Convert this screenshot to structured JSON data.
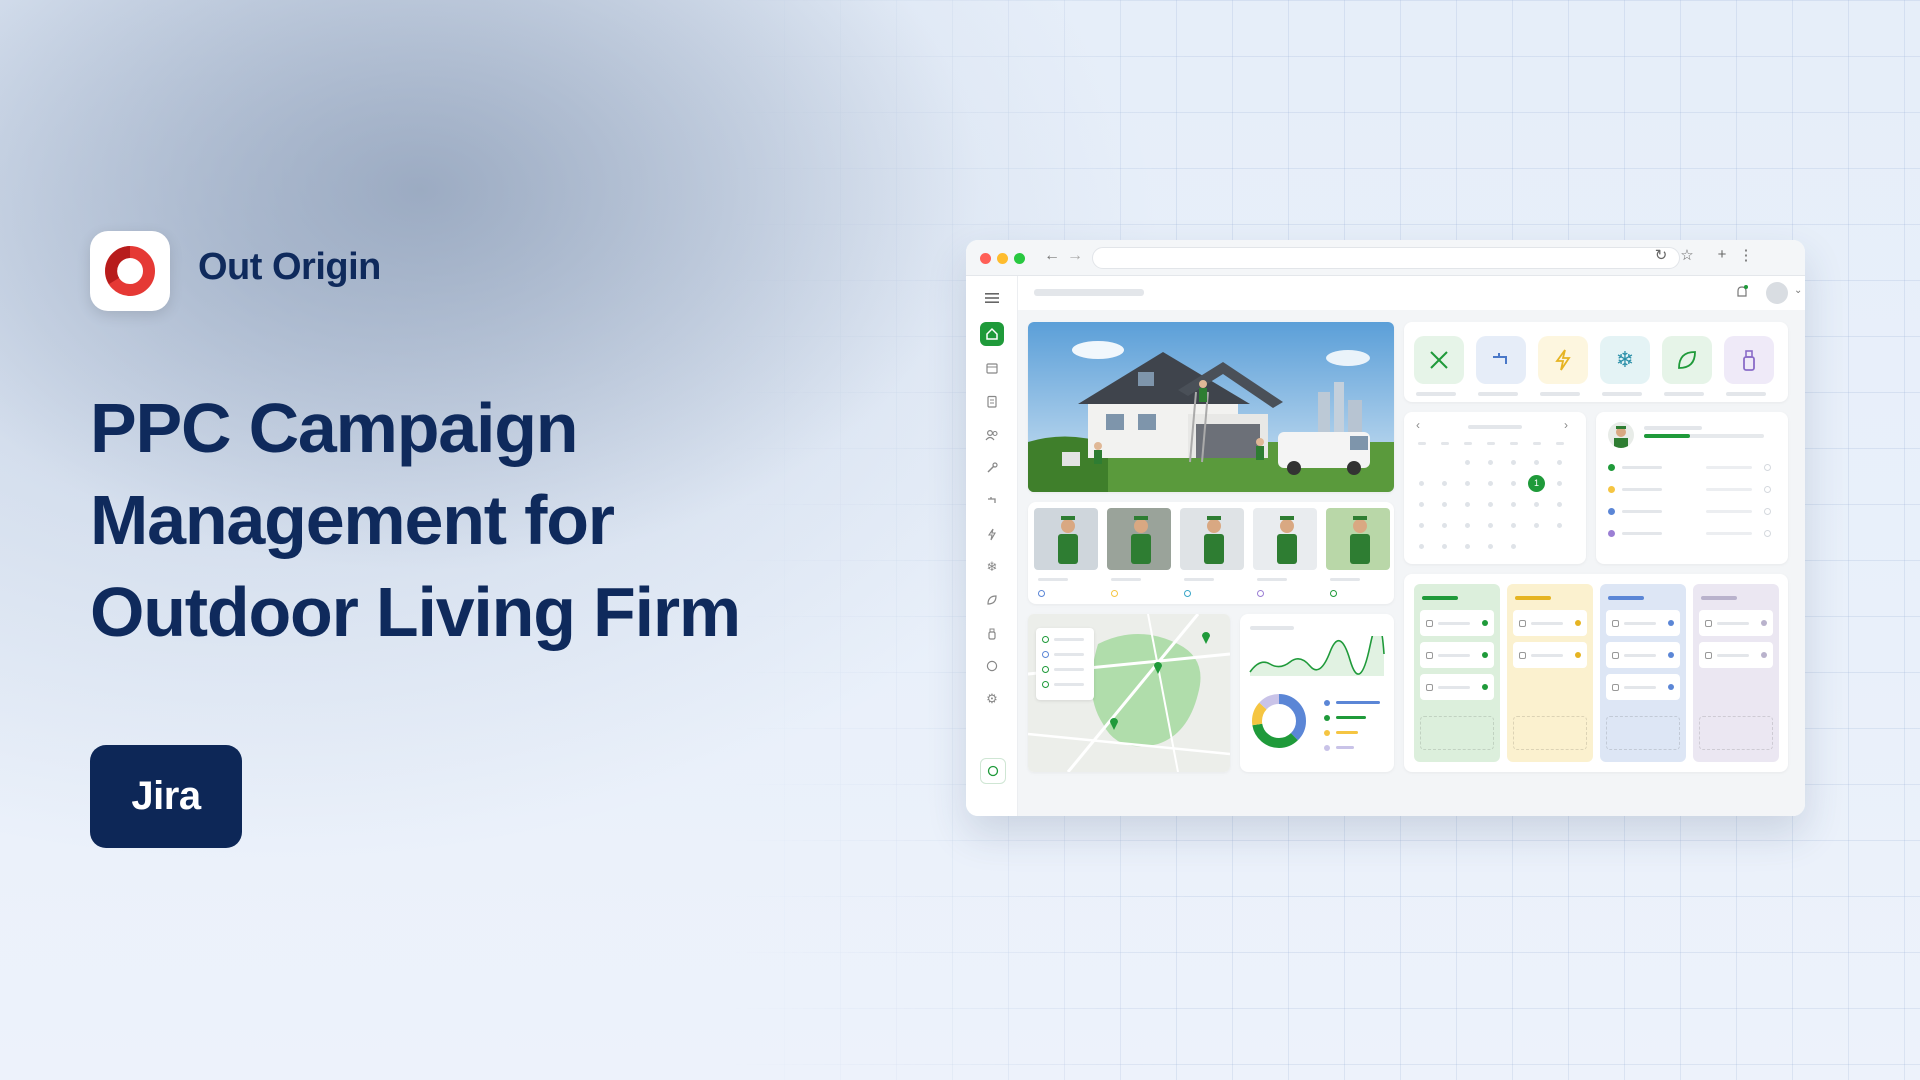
{
  "brand": {
    "name": "Out Origin",
    "logo_icon": "ring-logo",
    "logo_colors": [
      "#e53935",
      "#b71c1c"
    ]
  },
  "headline": [
    "PPC Campaign",
    "Management for",
    "Outdoor Living Firm"
  ],
  "cta": {
    "label": "Jira",
    "background": "#0d2757"
  },
  "colors": {
    "text_dark": "#0f2a5c",
    "accent_green": "#1f9a3a",
    "accent_yellow": "#f5c542",
    "accent_blue": "#5b86d6",
    "accent_purple": "#9b7fd4"
  },
  "mockup": {
    "window_dots": [
      "#ff5f57",
      "#febc2e",
      "#28c840"
    ],
    "toolbar_icons": [
      "back-arrow-icon",
      "forward-arrow-icon",
      "reload-icon",
      "star-icon",
      "plus-icon",
      "more-icon"
    ],
    "sidebar_icons": [
      "menu-icon",
      "home-icon",
      "calendar-icon",
      "clipboard-icon",
      "users-icon",
      "wrench-icon",
      "faucet-icon",
      "lightning-icon",
      "snowflake-icon",
      "leaf-icon",
      "spray-bottle-icon",
      "chat-icon",
      "settings-icon",
      "support-icon"
    ],
    "service_icons": [
      {
        "icon": "tools-icon",
        "color": "#1f9a3a"
      },
      {
        "icon": "faucet-icon",
        "color": "#4a78c8"
      },
      {
        "icon": "lightning-icon",
        "color": "#e6b422"
      },
      {
        "icon": "snowflake-icon",
        "color": "#2a8fa8"
      },
      {
        "icon": "leaf-icon",
        "color": "#1f9a3a"
      },
      {
        "icon": "spray-bottle-icon",
        "color": "#8a6cc8"
      }
    ],
    "calendar_selected_day": "1",
    "thumb_dot_colors": [
      "#5b86d6",
      "#f5c542",
      "#3aa6c8",
      "#9b7fd4",
      "#1f9a3a"
    ],
    "list_dot_colors": [
      "#1f9a3a",
      "#f5c542",
      "#5b86d6",
      "#9b7fd4"
    ],
    "donut_colors": [
      "#5b86d6",
      "#1f9a3a",
      "#f5c542",
      "#c9c3e8"
    ],
    "kanban_colors": [
      "#dcefdc",
      "#fbf1cf",
      "#dde6f5",
      "#ebe7f2"
    ]
  }
}
